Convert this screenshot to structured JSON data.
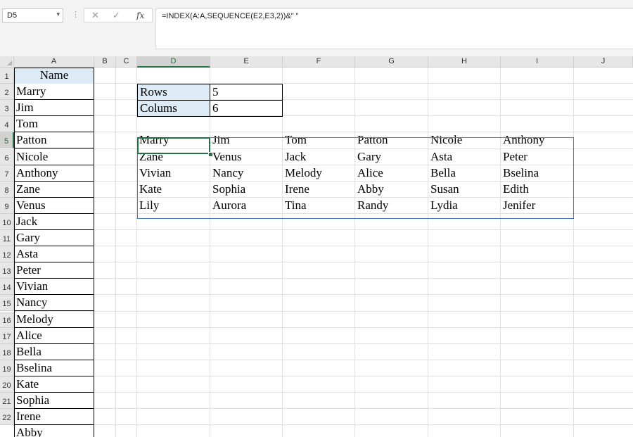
{
  "name_box": {
    "value": "D5"
  },
  "formula_bar": {
    "formula": "=INDEX(A:A,SEQUENCE(E2,E3,2))&\" \""
  },
  "icons": {
    "cancel": "✕",
    "enter": "✓",
    "fx": "fx",
    "dropdown": "▾",
    "dots": "⋮"
  },
  "columns": [
    "A",
    "B",
    "C",
    "D",
    "E",
    "F",
    "G",
    "H",
    "I",
    "J"
  ],
  "rows": [
    "1",
    "2",
    "3",
    "4",
    "5",
    "6",
    "7",
    "8",
    "9",
    "10",
    "11",
    "12",
    "13",
    "14",
    "15",
    "16",
    "17",
    "18",
    "19",
    "20",
    "21",
    "22"
  ],
  "active_cell": {
    "column": "D",
    "row": "5"
  },
  "colors": {
    "header_fill": "#ddebf7",
    "selection": "#217346",
    "spill_border": "#4a7fd0"
  },
  "sheet": {
    "name_header": "Name",
    "names": [
      "Marry",
      "Jim",
      "Tom",
      "Patton",
      "Nicole",
      "Anthony",
      "Zane",
      "Venus",
      "Jack",
      "Gary",
      "Asta",
      "Peter",
      "Vivian",
      "Nancy",
      "Melody",
      "Alice",
      "Bella",
      "Bselina",
      "Kate",
      "Sophia",
      "Irene",
      "Abby"
    ],
    "params": [
      {
        "label": "Rows",
        "value": "5"
      },
      {
        "label": "Colums",
        "value": "6"
      }
    ],
    "spill": [
      [
        "Marry",
        "Jim",
        "Tom",
        "Patton",
        "Nicole",
        "Anthony"
      ],
      [
        "Zane",
        "Venus",
        "Jack",
        "Gary",
        "Asta",
        "Peter"
      ],
      [
        "Vivian",
        "Nancy",
        "Melody",
        "Alice",
        "Bella",
        "Bselina"
      ],
      [
        "Kate",
        "Sophia",
        "Irene",
        "Abby",
        "Susan",
        "Edith"
      ],
      [
        "Lily",
        "Aurora",
        "Tina",
        "Randy",
        "Lydia",
        "Jenifer"
      ]
    ]
  }
}
